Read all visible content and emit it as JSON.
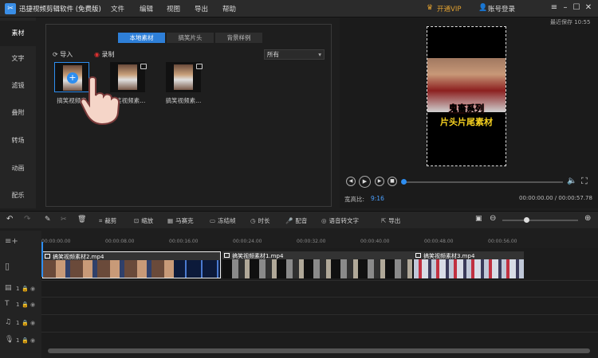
{
  "app": {
    "title": "迅捷视频剪辑软件 (免费版)",
    "menu": [
      "文件",
      "编辑",
      "视图",
      "导出",
      "帮助"
    ],
    "vip": "开通VIP",
    "login": "账号登录",
    "autosave": "最近保存 10:55"
  },
  "sidebar": {
    "items": [
      {
        "label": "素材",
        "active": true
      },
      {
        "label": "文字"
      },
      {
        "label": "滤镜"
      },
      {
        "label": "叠附"
      },
      {
        "label": "转场"
      },
      {
        "label": "动画"
      },
      {
        "label": "配乐"
      }
    ]
  },
  "media": {
    "tabs": [
      "本地素材",
      "搞笑片头",
      "背景样例"
    ],
    "import_label": "导入",
    "record_label": "录制",
    "filter_value": "所有",
    "thumbs": [
      {
        "label": "搞笑视频素"
      },
      {
        "label": "搞笑视频素..."
      },
      {
        "label": "搞笑视频素..."
      }
    ]
  },
  "preview": {
    "caption_line1": "鬼畜系列",
    "caption_line2": "片头片尾素材",
    "aspect_label": "宽高比:",
    "aspect_value": "9:16",
    "timecode": "00:00:00.00 / 00:00:57.78",
    "progress": 0
  },
  "toolbar": {
    "tools": [
      "裁剪",
      "缩放",
      "马赛克",
      "冻结帧",
      "时长",
      "配音",
      "语音转文字",
      "导出"
    ]
  },
  "timeline": {
    "ticks": [
      "00:00:00.00",
      "00:00:08.00",
      "00:00:16.00",
      "00:00:24.00",
      "00:00:32.00",
      "00:00:40.00",
      "00:00:48.00",
      "00:00:56.00"
    ],
    "clips": [
      {
        "name": "搞笑视频素材2.mp4"
      },
      {
        "name": "搞笑视频素材1.mp4"
      },
      {
        "name": "搞笑视频素材3.mp4"
      }
    ],
    "tracks": [
      {
        "icon": "video-track-icon",
        "num": "1"
      },
      {
        "icon": "text-track-icon",
        "num": "1"
      },
      {
        "icon": "music-track-icon",
        "num": "1"
      },
      {
        "icon": "voice-track-icon",
        "num": "1"
      }
    ]
  },
  "colors": {
    "accent": "#2e7fd8",
    "vip": "#e0a030",
    "caption_yellow": "#f5d020"
  }
}
